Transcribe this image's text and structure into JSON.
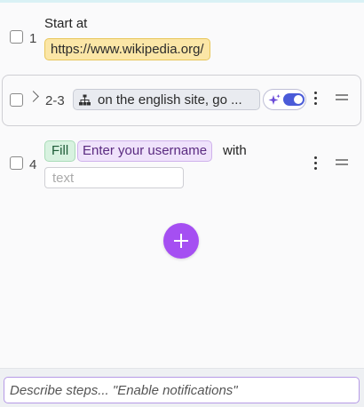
{
  "steps": [
    {
      "number": "1",
      "label": "Start at",
      "url": "https://www.wikipedia.org/"
    },
    {
      "number": "2-3",
      "group_text": "on the english site, go ...",
      "ai_enabled": true
    },
    {
      "number": "4",
      "action": "Fill",
      "target": "Enter your username",
      "with_label": "with",
      "input_placeholder": "text"
    }
  ],
  "composer": {
    "placeholder": "Describe steps... \"Enable notifications\""
  },
  "colors": {
    "url_badge": "#fbe6a6",
    "fill_badge": "#d8f2e0",
    "target_badge": "#efe2fb",
    "toggle_on": "#4a5bd8",
    "add_button": "#a54ff2"
  },
  "icons": {
    "group": "sitemap-icon",
    "ai": "sparkle-icon",
    "menu": "kebab-icon",
    "drag": "drag-handle-icon",
    "add": "plus-icon"
  }
}
